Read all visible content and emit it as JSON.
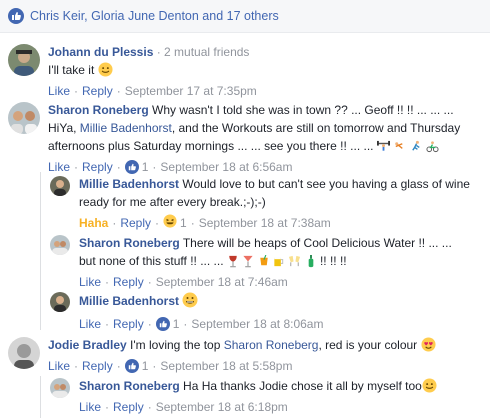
{
  "reactions": {
    "names": "Chris Keir, Gloria June Denton and 17 others"
  },
  "comments": [
    {
      "author": "Johann du Plessis",
      "meta": "· 2 mutual friends",
      "text": "I'll take it",
      "like": "Like",
      "reply": "Reply",
      "time": "September 17 at 7:35pm"
    },
    {
      "author": "Sharon Roneberg",
      "text_a": "Why wasn't I told she was in town ?? ... Geoff !! !! ... ... ...",
      "text_b_pre": "HiYa,",
      "mention": "Millie Badenhorst",
      "text_b_post": ", and the Workouts are still on tomorrow and Thursday",
      "text_c": "afternoons plus Saturday mornings ... ... see you there !! ... ...",
      "like": "Like",
      "reply": "Reply",
      "reaction_count": "1",
      "time": "September 18 at 6:56am"
    }
  ],
  "replies": [
    {
      "author": "Millie Badenhorst",
      "text_a": "Would love to but can't see you having a glass of wine",
      "text_b": "ready for me after every break.;-);-)",
      "reaction_label": "Haha",
      "reply": "Reply",
      "reaction_count": "1",
      "time": "September 18 at 7:38am"
    },
    {
      "author": "Sharon Roneberg",
      "text_a": "There will be heaps of Cool Delicious Water !! ... ...",
      "text_b": "but none of this stuff !! ... ...",
      "text_b_end": "!! !! !!",
      "like": "Like",
      "reply": "Reply",
      "time": "September 18 at 7:46am"
    },
    {
      "author": "Millie Badenhorst",
      "like": "Like",
      "reply": "Reply",
      "reaction_count": "1",
      "time": "September 18 at 8:06am"
    }
  ],
  "comment3": {
    "author": "Jodie Bradley",
    "text_pre": "I'm loving the top",
    "mention": "Sharon Roneberg",
    "text_post": ", red is your colour",
    "like": "Like",
    "reply": "Reply",
    "reaction_count": "1",
    "time": "September 18 at 5:58pm"
  },
  "reply4": {
    "author": "Sharon Roneberg",
    "text": "Ha Ha thanks Jodie chose it all by myself too",
    "like": "Like",
    "reply": "Reply",
    "time": "September 18 at 6:18pm"
  },
  "colors": {
    "link": "#385898",
    "action": "#4267b2",
    "muted": "#90949c",
    "haha": "#f7b125"
  }
}
